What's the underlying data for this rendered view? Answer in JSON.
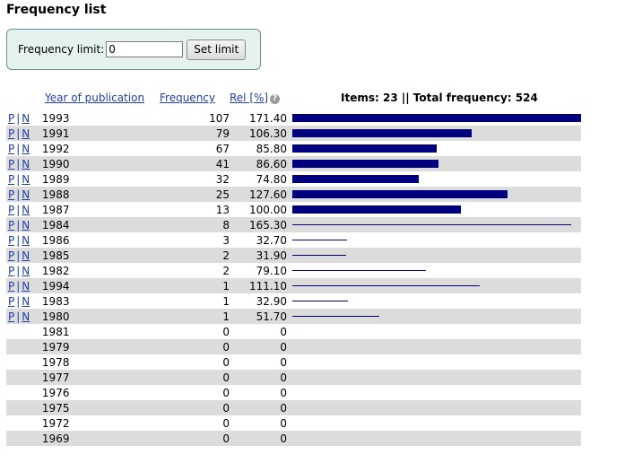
{
  "page": {
    "title": "Frequency list"
  },
  "limit_form": {
    "label": "Frequency limit:",
    "value": "0",
    "button_label": "Set limit"
  },
  "table": {
    "headers": {
      "year": "Year of publication",
      "frequency": "Frequency",
      "rel": "Rel [%]"
    },
    "help_icon_glyph": "?",
    "summary": "Items: 23 || Total frequency: 524",
    "link_p": "P",
    "link_sep": "|",
    "link_n": "N",
    "bar_color": "#00007f",
    "max_rel": 171.4,
    "rows": [
      {
        "year": "1993",
        "freq": "107",
        "rel": "171.40",
        "rel_value": 171.4,
        "links": true
      },
      {
        "year": "1991",
        "freq": "79",
        "rel": "106.30",
        "rel_value": 106.3,
        "links": true
      },
      {
        "year": "1992",
        "freq": "67",
        "rel": "85.80",
        "rel_value": 85.8,
        "links": true
      },
      {
        "year": "1990",
        "freq": "41",
        "rel": "86.60",
        "rel_value": 86.6,
        "links": true
      },
      {
        "year": "1989",
        "freq": "32",
        "rel": "74.80",
        "rel_value": 74.8,
        "links": true
      },
      {
        "year": "1988",
        "freq": "25",
        "rel": "127.60",
        "rel_value": 127.6,
        "links": true
      },
      {
        "year": "1987",
        "freq": "13",
        "rel": "100.00",
        "rel_value": 100.0,
        "links": true
      },
      {
        "year": "1984",
        "freq": "8",
        "rel": "165.30",
        "rel_value": 165.3,
        "links": true
      },
      {
        "year": "1986",
        "freq": "3",
        "rel": "32.70",
        "rel_value": 32.7,
        "links": true
      },
      {
        "year": "1985",
        "freq": "2",
        "rel": "31.90",
        "rel_value": 31.9,
        "links": true
      },
      {
        "year": "1982",
        "freq": "2",
        "rel": "79.10",
        "rel_value": 79.1,
        "links": true
      },
      {
        "year": "1994",
        "freq": "1",
        "rel": "111.10",
        "rel_value": 111.1,
        "links": true
      },
      {
        "year": "1983",
        "freq": "1",
        "rel": "32.90",
        "rel_value": 32.9,
        "links": true
      },
      {
        "year": "1980",
        "freq": "1",
        "rel": "51.70",
        "rel_value": 51.7,
        "links": true
      },
      {
        "year": "1981",
        "freq": "0",
        "rel": "0",
        "rel_value": 0,
        "links": false
      },
      {
        "year": "1979",
        "freq": "0",
        "rel": "0",
        "rel_value": 0,
        "links": false
      },
      {
        "year": "1978",
        "freq": "0",
        "rel": "0",
        "rel_value": 0,
        "links": false
      },
      {
        "year": "1977",
        "freq": "0",
        "rel": "0",
        "rel_value": 0,
        "links": false
      },
      {
        "year": "1976",
        "freq": "0",
        "rel": "0",
        "rel_value": 0,
        "links": false
      },
      {
        "year": "1975",
        "freq": "0",
        "rel": "0",
        "rel_value": 0,
        "links": false
      },
      {
        "year": "1972",
        "freq": "0",
        "rel": "0",
        "rel_value": 0,
        "links": false
      },
      {
        "year": "1969",
        "freq": "0",
        "rel": "0",
        "rel_value": 0,
        "links": false
      }
    ]
  }
}
